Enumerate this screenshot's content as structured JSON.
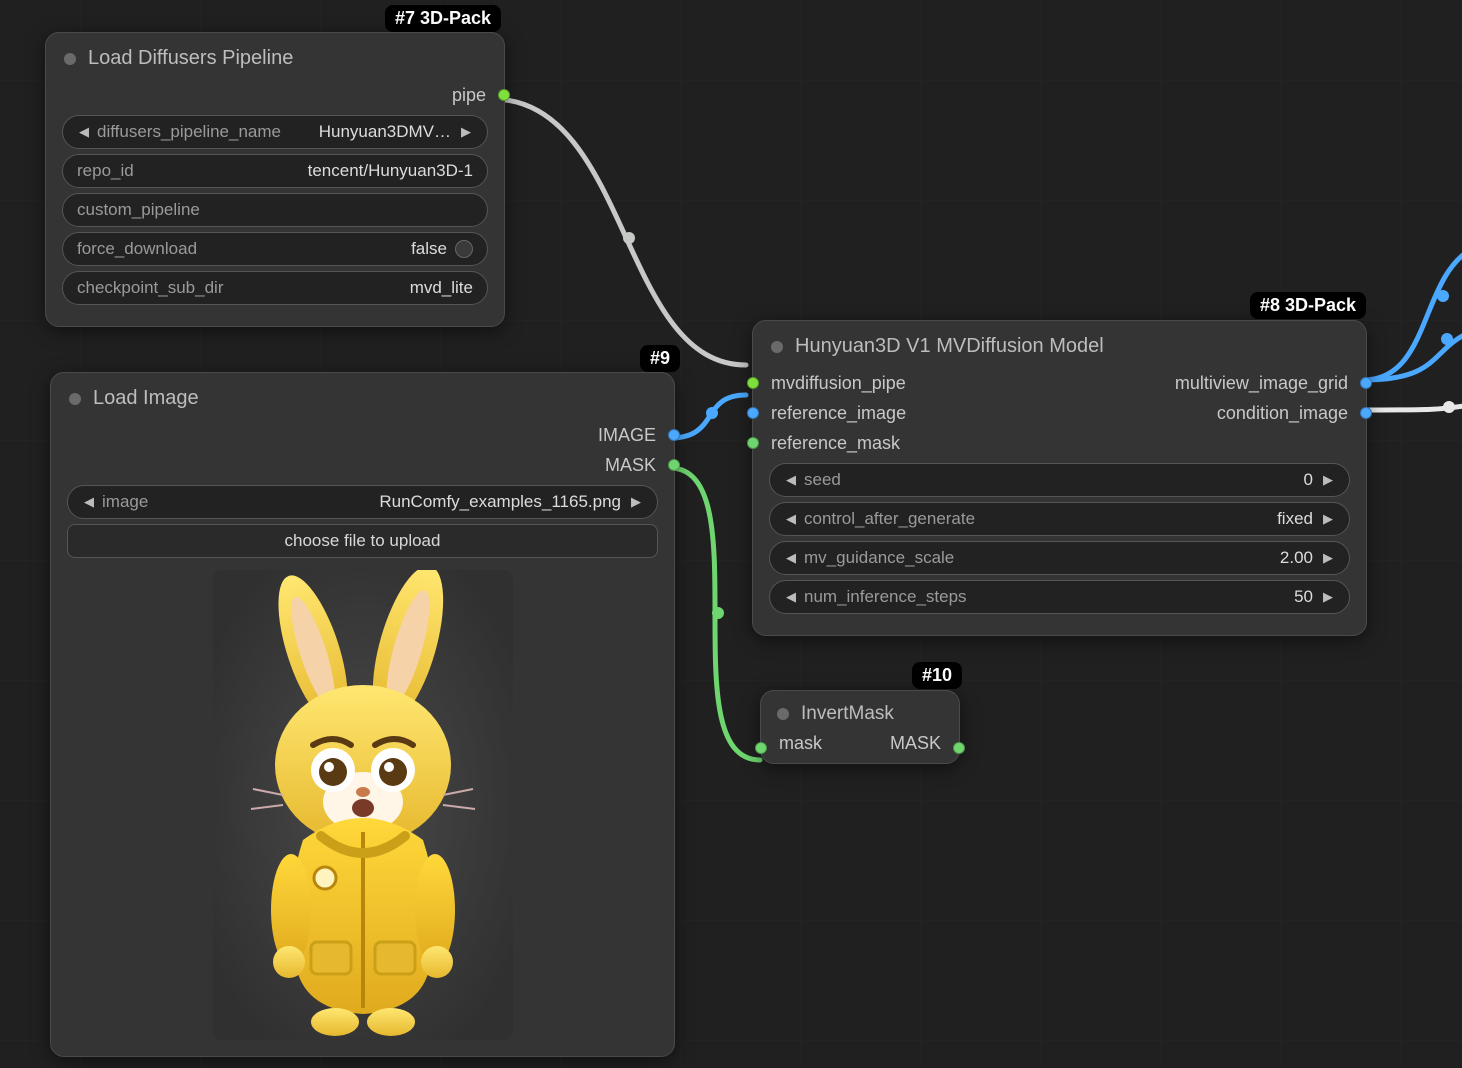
{
  "badges": {
    "n7": "#7 3D-Pack",
    "n8": "#8 3D-Pack",
    "n9": "#9",
    "n10": "#10"
  },
  "colors": {
    "pipe": "#7ee03b",
    "image": "#4aa8ff",
    "mask": "#6fd66f",
    "edge_pipe": "#c7c9c7",
    "edge_image": "#4aa8ff",
    "edge_mask": "#6fd66f",
    "edge_white": "#e8e8e8"
  },
  "node7": {
    "title": "Load Diffusers Pipeline",
    "out_pipe": "pipe",
    "w_pipeline_label": "diffusers_pipeline_name",
    "w_pipeline_value": "Hunyuan3DMV…",
    "w_repo_label": "repo_id",
    "w_repo_value": "tencent/Hunyuan3D-1",
    "w_custom_label": "custom_pipeline",
    "w_custom_value": "",
    "w_force_label": "force_download",
    "w_force_value": "false",
    "w_ckpt_label": "checkpoint_sub_dir",
    "w_ckpt_value": "mvd_lite"
  },
  "node9": {
    "title": "Load Image",
    "out_image": "IMAGE",
    "out_mask": "MASK",
    "w_image_label": "image",
    "w_image_value": "RunComfy_examples_1165.png",
    "button_upload": "choose file to upload"
  },
  "node8": {
    "title": "Hunyuan3D V1 MVDiffusion Model",
    "in_pipe": "mvdiffusion_pipe",
    "in_image": "reference_image",
    "in_mask": "reference_mask",
    "out_grid": "multiview_image_grid",
    "out_cond": "condition_image",
    "w_seed_label": "seed",
    "w_seed_value": "0",
    "w_control_label": "control_after_generate",
    "w_control_value": "fixed",
    "w_mv_label": "mv_guidance_scale",
    "w_mv_value": "2.00",
    "w_steps_label": "num_inference_steps",
    "w_steps_value": "50"
  },
  "node10": {
    "title": "InvertMask",
    "in_mask": "mask",
    "out_mask": "MASK"
  }
}
